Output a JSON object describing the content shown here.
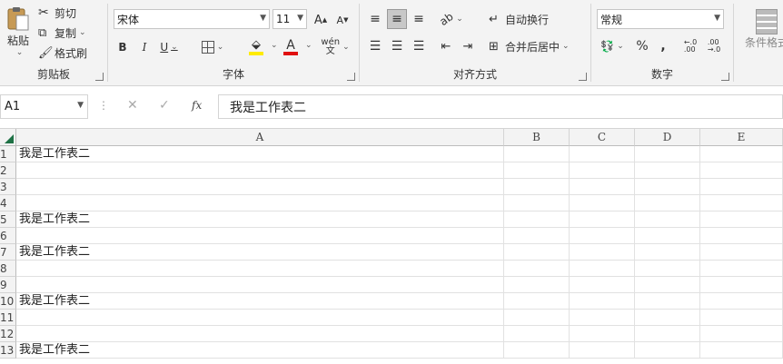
{
  "ribbon": {
    "clipboard": {
      "label": "剪贴板",
      "paste": "粘贴",
      "cut": "剪切",
      "copy": "复制",
      "format_painter": "格式刷"
    },
    "font": {
      "label": "字体",
      "font_name": "宋体",
      "font_size": "11"
    },
    "alignment": {
      "label": "对齐方式",
      "wrap_text": "自动换行",
      "merge_center": "合并后居中"
    },
    "number": {
      "label": "数字",
      "format": "常规"
    },
    "styles": {
      "conditional_format": "条件格式"
    }
  },
  "formula_bar": {
    "name_box": "A1",
    "content": "我是工作表二",
    "fx": "fx"
  },
  "grid": {
    "columns": [
      "A",
      "B",
      "C",
      "D",
      "E"
    ],
    "rows": [
      "1",
      "2",
      "3",
      "4",
      "5",
      "6",
      "7",
      "8",
      "9",
      "10",
      "11",
      "12",
      "13"
    ],
    "cells": {
      "A1": "我是工作表二",
      "A5": "我是工作表二",
      "A7": "我是工作表二",
      "A10": "我是工作表二",
      "A13": "我是工作表二"
    }
  },
  "colors": {
    "font_color": "#e01010",
    "fill_color": "#ffeb00",
    "select_triangle": "#1e7145"
  }
}
